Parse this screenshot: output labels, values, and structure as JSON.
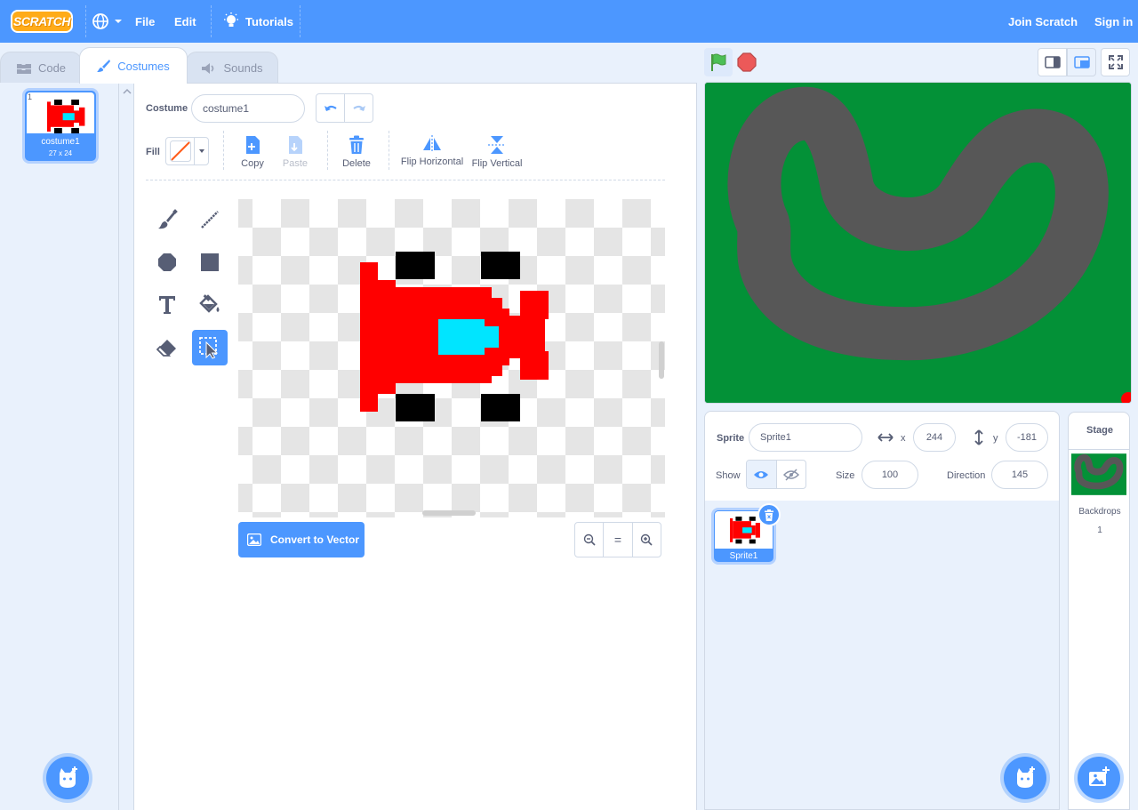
{
  "menu": {
    "logo": "SCRATCH",
    "file": "File",
    "edit": "Edit",
    "tutorials": "Tutorials",
    "join": "Join Scratch",
    "sign_in": "Sign in"
  },
  "tabs": [
    {
      "label": "Code",
      "active": false
    },
    {
      "label": "Costumes",
      "active": true
    },
    {
      "label": "Sounds",
      "active": false
    }
  ],
  "costume_list": {
    "items": [
      {
        "number": "1",
        "name": "costume1",
        "size": "27 x 24"
      }
    ]
  },
  "editor": {
    "costume_label": "Costume",
    "costume_name": "costume1",
    "fill_label": "Fill",
    "copy": "Copy",
    "paste": "Paste",
    "delete": "Delete",
    "flip_horizontal": "Flip Horizontal",
    "flip_vertical": "Flip Vertical",
    "convert": "Convert to Vector",
    "zoom_reset": "="
  },
  "sprite_info": {
    "sprite_label": "Sprite",
    "sprite_name": "Sprite1",
    "x_label": "x",
    "x_value": "244",
    "y_label": "y",
    "y_value": "-181",
    "show_label": "Show",
    "size_label": "Size",
    "size_value": "100",
    "direction_label": "Direction",
    "direction_value": "145"
  },
  "sprites": [
    {
      "name": "Sprite1"
    }
  ],
  "stage_pane": {
    "title": "Stage",
    "backdrops_label": "Backdrops",
    "backdrops_count": "1"
  },
  "colors": {
    "accent": "#4c97ff",
    "grass": "#039137",
    "track": "#575757",
    "car_body": "#ff0000",
    "car_window": "#00e5ff"
  }
}
